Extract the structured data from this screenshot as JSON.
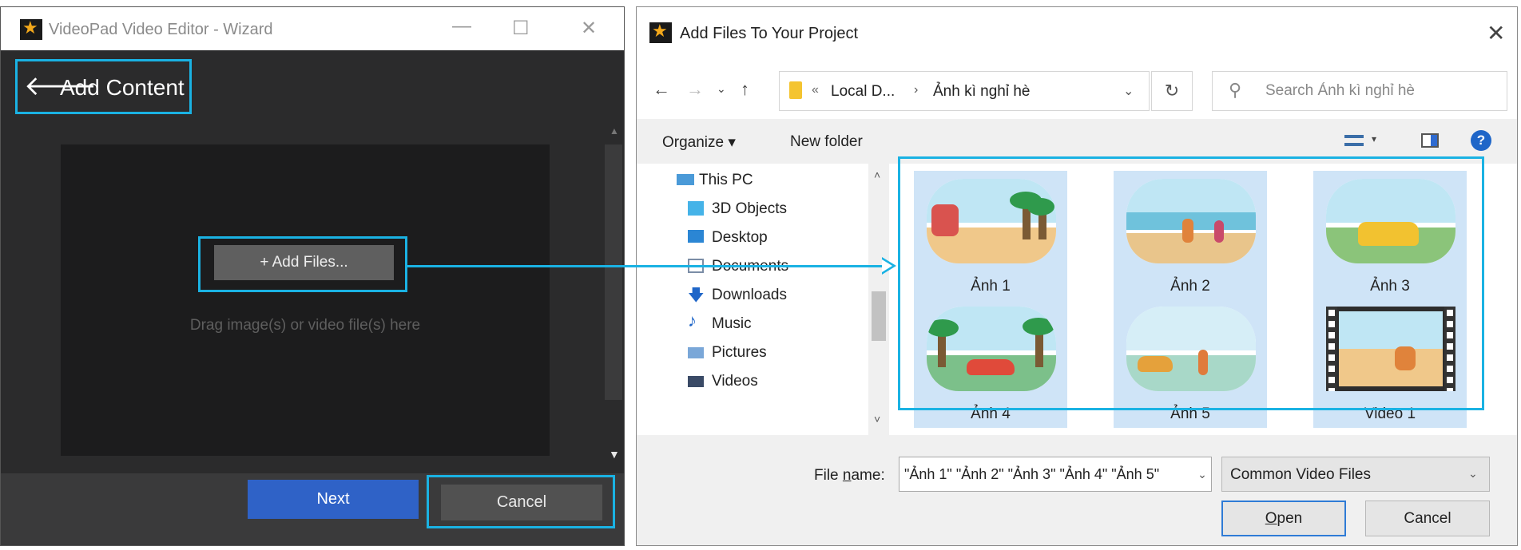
{
  "wizard": {
    "title": "VideoPad Video Editor - Wizard",
    "minimize": "—",
    "maximize": "☐",
    "close": "✕",
    "back_glyph": "🡐",
    "header": "Add Content",
    "add_files_label": "+ Add Files...",
    "drop_hint": "Drag image(s) or video file(s) here",
    "next_label": "Next",
    "cancel_label": "Cancel",
    "scroll_up": "▲",
    "scroll_down": "▼"
  },
  "dialog": {
    "title": "Add Files To Your Project",
    "close": "✕",
    "nav": {
      "back": "←",
      "forward": "→",
      "recent": "⌄",
      "up": "↑",
      "refresh": "↻"
    },
    "address": {
      "chevrons": "«",
      "parent": "Local D...",
      "separator": "›",
      "folder": "Ảnh kì nghỉ hè",
      "dropdown": "⌄"
    },
    "search_placeholder": "Search Ảnh kì nghỉ hè",
    "search_glyph": "⚲",
    "toolbar": {
      "organize": "Organize ▾",
      "new_folder": "New folder",
      "view_dropdown": "▾",
      "help": "?"
    },
    "nav_pane": {
      "scroll_up": "˄",
      "scroll_down": "˅",
      "items": [
        {
          "label": "This PC"
        },
        {
          "label": "3D Objects"
        },
        {
          "label": "Desktop"
        },
        {
          "label": "Documents"
        },
        {
          "label": "Downloads",
          "glyph": "🡇"
        },
        {
          "label": "Music",
          "glyph": "♪"
        },
        {
          "label": "Pictures"
        },
        {
          "label": "Videos"
        }
      ]
    },
    "files": [
      {
        "label": "Ảnh 1"
      },
      {
        "label": "Ảnh 2"
      },
      {
        "label": "Ảnh 3"
      },
      {
        "label": "Ảnh 4"
      },
      {
        "label": "Ảnh 5"
      },
      {
        "label": "Video 1"
      }
    ],
    "filename_label_pre": "File ",
    "filename_label_u": "n",
    "filename_label_post": "ame:",
    "filename_value": "\"Ảnh 1\" \"Ảnh 2\" \"Ảnh 3\" \"Ảnh 4\" \"Ảnh 5\"",
    "filename_dropdown": "⌄",
    "filetype_value": "Common Video Files",
    "filetype_dropdown": "⌄",
    "open_u": "O",
    "open_rest": "pen",
    "cancel_label": "Cancel"
  },
  "colors": {
    "highlight": "#1ab2e3",
    "next_button": "#2f62c7",
    "tile_selected": "#cfe4f7"
  }
}
